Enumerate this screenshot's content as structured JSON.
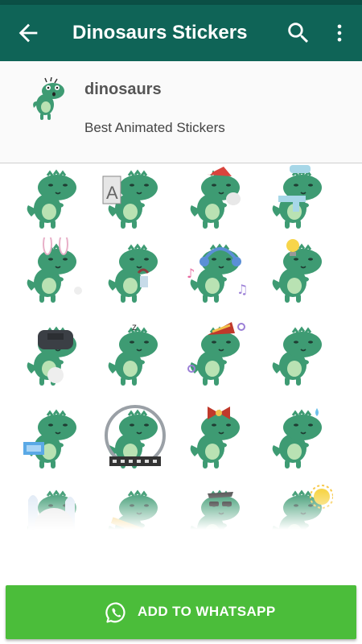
{
  "app_bar": {
    "title": "Dinosaurs Stickers",
    "back_icon": "arrow-back-icon",
    "search_icon": "search-icon",
    "more_icon": "more-vert-icon"
  },
  "pack": {
    "name": "dinosaurs",
    "publisher": "Best Animated Stickers",
    "tray_icon": "dinosaur-tray-icon"
  },
  "stickers": [
    {
      "name": "dino-shocked-sticker",
      "accessory": "none"
    },
    {
      "name": "dino-sign-a-sticker",
      "accessory": "sign"
    },
    {
      "name": "dino-santa-sticker",
      "accessory": "santa-hat"
    },
    {
      "name": "dino-scarf-sticker",
      "accessory": "scarf"
    },
    {
      "name": "dino-bunny-ears-sticker",
      "accessory": "bunny-ears"
    },
    {
      "name": "dino-coffee-sticker",
      "accessory": "cup"
    },
    {
      "name": "dino-headphones-sticker",
      "accessory": "headphones"
    },
    {
      "name": "dino-idea-sticker",
      "accessory": "lightbulb"
    },
    {
      "name": "dino-vr-headset-sticker",
      "accessory": "headset"
    },
    {
      "name": "dino-sleepy-sticker",
      "accessory": "zzz"
    },
    {
      "name": "dino-party-hat-sticker",
      "accessory": "party-hat"
    },
    {
      "name": "dino-shocked-blink-sticker",
      "accessory": "none"
    },
    {
      "name": "dino-laptop-sticker",
      "accessory": "laptop"
    },
    {
      "name": "dino-astronaut-sticker",
      "accessory": "helmet"
    },
    {
      "name": "dino-bow-sticker",
      "accessory": "bow"
    },
    {
      "name": "dino-blush-sticker",
      "accessory": "sweat"
    },
    {
      "name": "dino-ghosts-sticker",
      "accessory": "ghosts"
    },
    {
      "name": "dino-pencil-sticker",
      "accessory": "pencil"
    },
    {
      "name": "dino-sunglasses-sticker",
      "accessory": "sunglasses"
    },
    {
      "name": "dino-sun-sticker",
      "accessory": "sun"
    }
  ],
  "colors": {
    "app_bar": "#0f6457",
    "status_bar": "#0b4f45",
    "button": "#4bbd3a",
    "dino_green": "#3e9b73",
    "dino_belly": "#b9e2b3"
  },
  "add_button": {
    "label": "ADD TO WHATSAPP",
    "icon": "whatsapp-icon"
  }
}
